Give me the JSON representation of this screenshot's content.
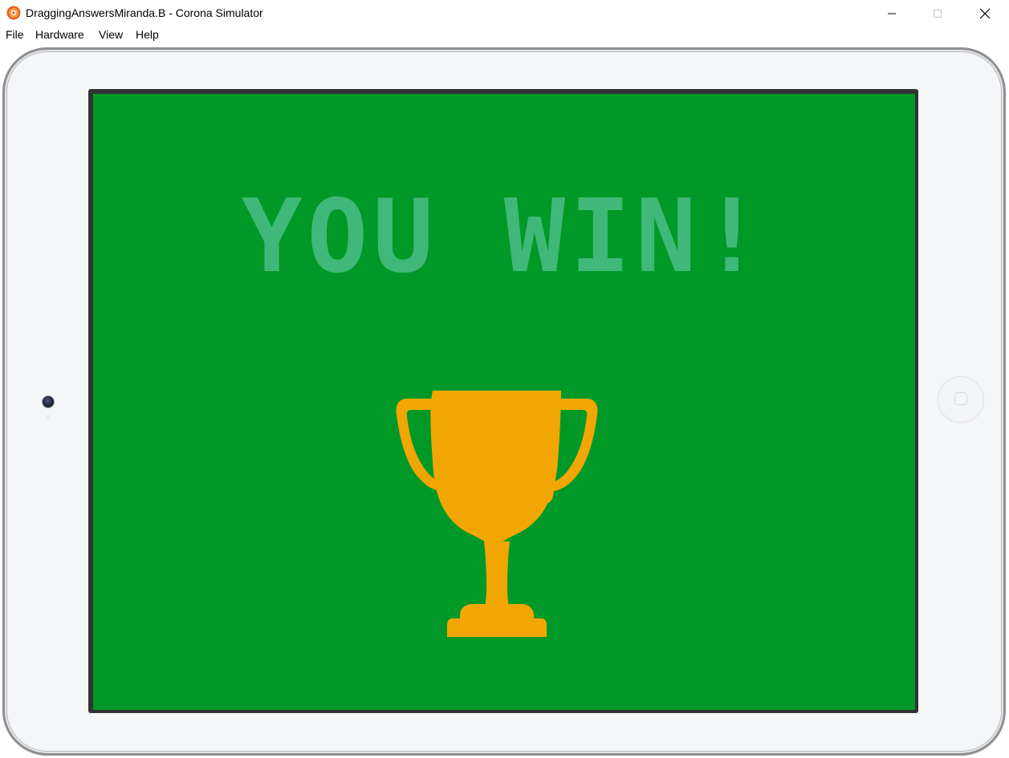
{
  "window": {
    "title": "DraggingAnswersMiranda.B - Corona Simulator",
    "app_icon": "corona-logo-icon",
    "controls": [
      "minimize-icon",
      "maximize-icon",
      "close-icon"
    ]
  },
  "menu": {
    "file": "File",
    "hardware": "Hardware",
    "view": "View",
    "help": "Help"
  },
  "game": {
    "message": "YOU WIN!",
    "trophy_icon": "trophy-icon"
  },
  "colors": {
    "screen_background": "#009927",
    "message_text": "#40b879",
    "trophy": "#f2a603",
    "device_frame": "#f5f6f8"
  }
}
